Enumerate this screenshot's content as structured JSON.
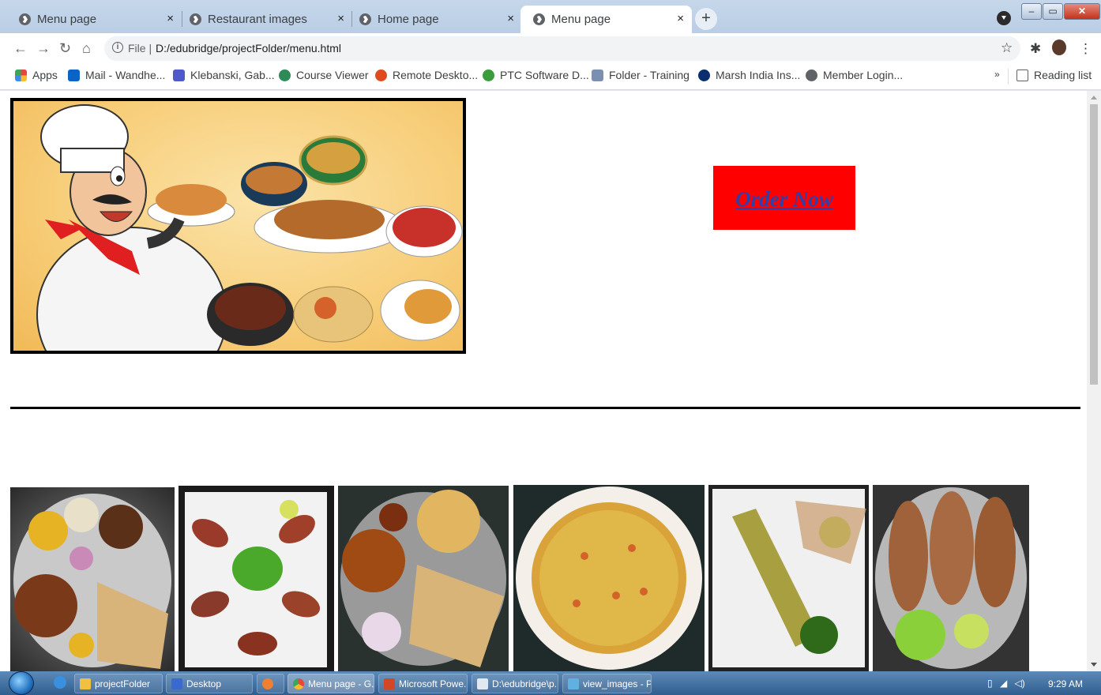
{
  "browser": {
    "tabs": [
      {
        "title": "Menu page",
        "active": false
      },
      {
        "title": "Restaurant images",
        "active": false
      },
      {
        "title": "Home page",
        "active": false
      },
      {
        "title": "Menu page",
        "active": true
      }
    ],
    "close_glyph": "×",
    "new_tab_glyph": "+",
    "address": {
      "scheme_label": "File",
      "separator": "|",
      "url": "D:/edubridge/projectFolder/menu.html"
    },
    "bookmarks": [
      {
        "label": "Apps",
        "icon": "apps-grid-icon",
        "color": "#e8453c"
      },
      {
        "label": "Mail - Wandhe...",
        "icon": "outlook-icon",
        "color": "#0a64c8"
      },
      {
        "label": "Klebanski, Gab...",
        "icon": "teams-icon",
        "color": "#5059c9"
      },
      {
        "label": "Course Viewer",
        "icon": "course-icon",
        "color": "#2e8b57"
      },
      {
        "label": "Remote Deskto...",
        "icon": "remote-desktop-icon",
        "color": "#e04a1f"
      },
      {
        "label": "PTC Software D...",
        "icon": "ptc-icon",
        "color": "#3a9c3a"
      },
      {
        "label": "Folder - Training",
        "icon": "folder-icon",
        "color": "#7b8fb0"
      },
      {
        "label": "Marsh India Ins...",
        "icon": "marsh-icon",
        "color": "#0b2e6e"
      },
      {
        "label": "Member Login...",
        "icon": "globe-icon",
        "color": "#5f6368"
      }
    ],
    "overflow_glyph": "»",
    "reading_list_label": "Reading list"
  },
  "page": {
    "order_button_label": "Order Now",
    "colors": {
      "order_bg": "#ff0000",
      "order_link": "#3040a8"
    },
    "dish_photos": [
      {
        "name": "thali-photo"
      },
      {
        "name": "tandoori-chicken-photo"
      },
      {
        "name": "curry-chapati-photo"
      },
      {
        "name": "pizza-photo"
      },
      {
        "name": "grilled-kebab-photo"
      },
      {
        "name": "fried-fish-photo"
      }
    ]
  },
  "taskbar": {
    "items": [
      {
        "label": "projectFolder",
        "icon": "folder-icon"
      },
      {
        "label": "Desktop",
        "icon": "desktop-icon"
      },
      {
        "label": "",
        "icon": "media-icon"
      },
      {
        "label": "Menu page - G...",
        "icon": "chrome-icon"
      },
      {
        "label": "Microsoft Powe...",
        "icon": "powerpoint-icon"
      },
      {
        "label": "D:\\edubridge\\p...",
        "icon": "notepad-icon"
      },
      {
        "label": "view_images - P...",
        "icon": "paint-icon"
      }
    ],
    "clock": "9:29 AM"
  }
}
